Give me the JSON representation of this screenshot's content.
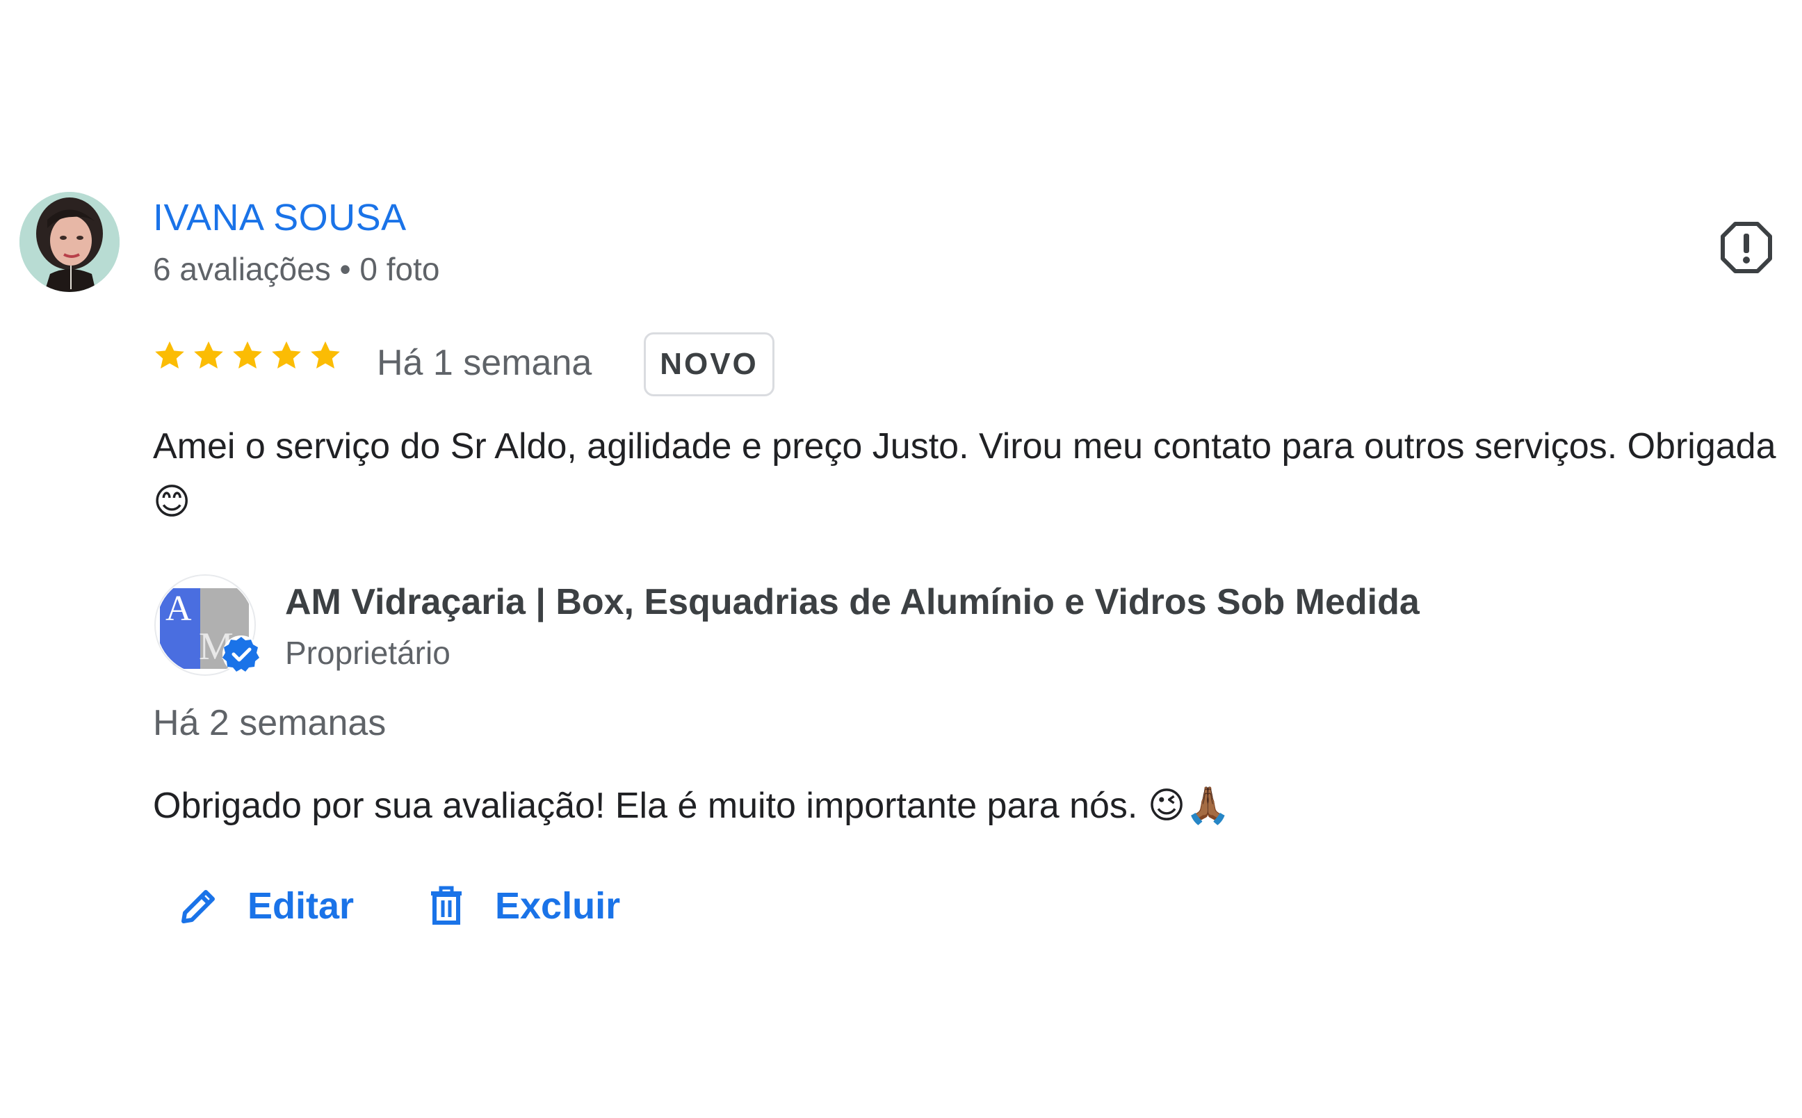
{
  "review": {
    "reviewer_name": "IVANA SOUSA",
    "reviewer_meta": "6 avaliações • 0 foto",
    "rating": 5,
    "rating_max": 5,
    "time": "Há 1 semana",
    "badge": "NOVO",
    "text": "Amei o serviço do Sr Aldo, agilidade e preço Justo. Virou meu contato para outros serviços. Obrigada 😊"
  },
  "reply": {
    "owner_name": "AM Vidraçaria | Box, Esquadrias de Alumínio e Vidros Sob Medida",
    "owner_role": "Proprietário",
    "logo_letters": "AM",
    "time": "Há 2 semanas",
    "text": "Obrigado por sua avaliação! Ela é muito importante para nós. 😉🙏🏾"
  },
  "actions": {
    "edit_label": "Editar",
    "delete_label": "Excluir"
  },
  "icons": {
    "report": "report-icon",
    "edit": "pencil-icon",
    "delete": "trash-icon",
    "verified": "verified-check-icon",
    "star": "star-icon"
  },
  "colors": {
    "link_blue": "#1a73e8",
    "star_gold": "#fbbc04",
    "secondary_text": "#5f6368",
    "verified_blue": "#1a73e8"
  }
}
